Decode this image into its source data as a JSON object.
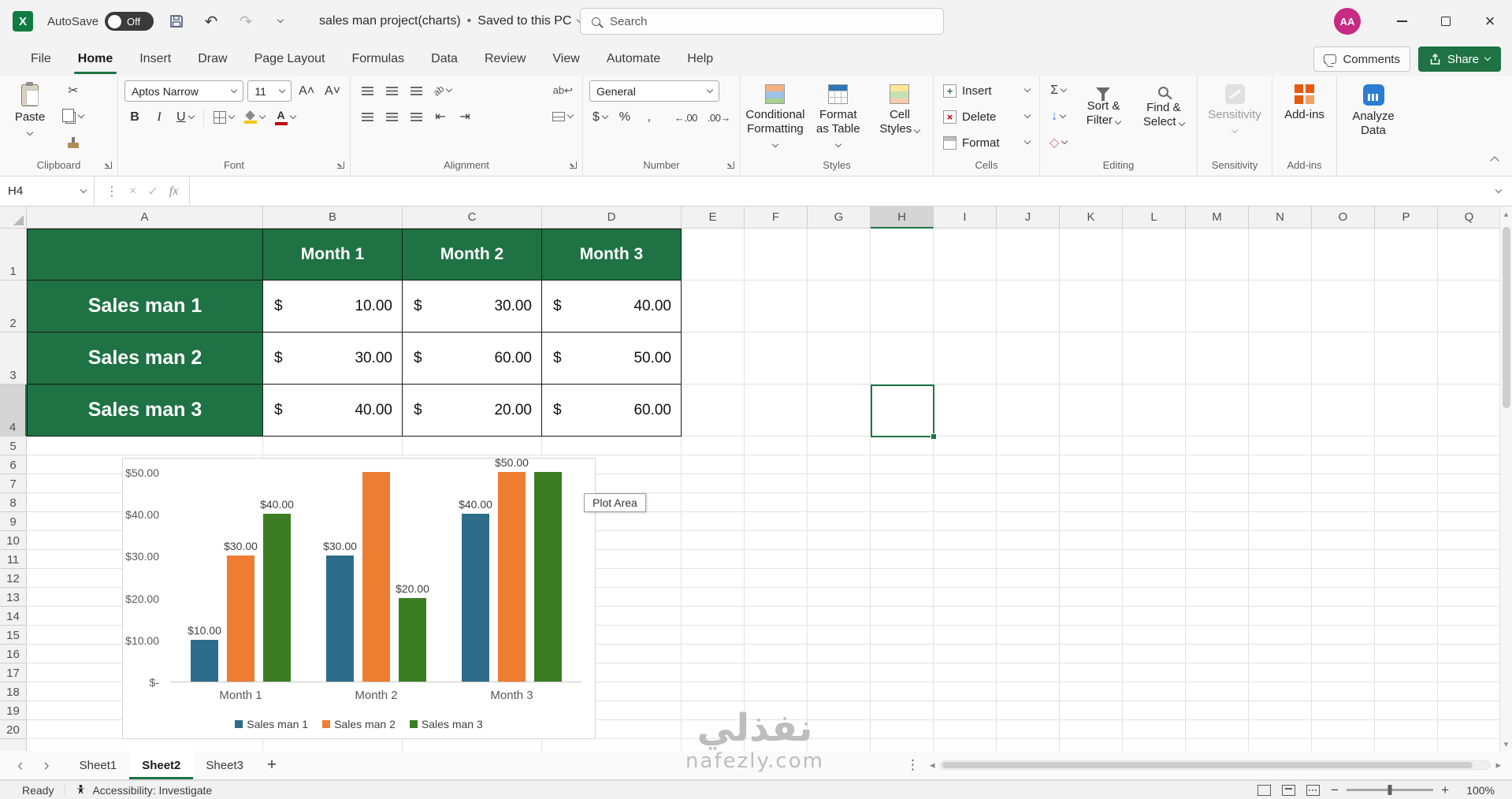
{
  "titlebar": {
    "autosave_label": "AutoSave",
    "autosave_state": "Off",
    "doc_title": "sales man project(charts)",
    "separator": "•",
    "saved_status": "Saved to this PC",
    "search_placeholder": "Search",
    "avatar_initials": "AA"
  },
  "ribbon_tabs": {
    "items": [
      "File",
      "Home",
      "Insert",
      "Draw",
      "Page Layout",
      "Formulas",
      "Data",
      "Review",
      "View",
      "Automate",
      "Help"
    ],
    "active": "Home",
    "comments_label": "Comments",
    "share_label": "Share"
  },
  "ribbon": {
    "groups": {
      "clipboard": {
        "label": "Clipboard",
        "paste": "Paste"
      },
      "font": {
        "label": "Font",
        "name": "Aptos Narrow",
        "size": "11"
      },
      "alignment": {
        "label": "Alignment"
      },
      "number": {
        "label": "Number",
        "format": "General"
      },
      "styles": {
        "label": "Styles",
        "conditional_formatting": "Conditional Formatting",
        "format_as_table": "Format as Table",
        "cell_styles": "Cell Styles"
      },
      "cells": {
        "label": "Cells",
        "insert": "Insert",
        "delete": "Delete",
        "format": "Format"
      },
      "editing": {
        "label": "Editing",
        "sort_filter": "Sort & Filter",
        "find_select": "Find & Select"
      },
      "sensitivity": {
        "label": "Sensitivity",
        "button": "Sensitivity"
      },
      "addins": {
        "label": "Add-ins",
        "button": "Add-ins"
      },
      "analyze": {
        "button": "Analyze Data"
      }
    }
  },
  "icons": {
    "cut": "✂",
    "bold": "B",
    "italic": "I",
    "underline": "U",
    "inc_font": "A˄",
    "dec_font": "A˅",
    "orientation": "ab",
    "wrap": "ab↩",
    "outdent": "⇤",
    "indent": "⇥",
    "currency": "$",
    "percent": "%",
    "comma": ",",
    "inc_decimal": "←.00",
    "dec_decimal": ".00→",
    "autosum": "Σ",
    "fill": "↓",
    "clear": "◇",
    "undo": "↶",
    "redo": "↷",
    "close": "×",
    "kebab": "⋮",
    "plus": "+",
    "nav_left": "‹",
    "nav_right": "›",
    "scroll_left": "◂",
    "scroll_right": "▸",
    "up_arrow": "▴",
    "down_arrow": "▾",
    "cancel": "×",
    "enter": "✓",
    "fx": "fx",
    "minus": "−",
    "plus_zoom": "+"
  },
  "formula_bar": {
    "name_box": "H4",
    "formula": ""
  },
  "grid": {
    "columns": [
      "A",
      "B",
      "C",
      "D",
      "E",
      "F",
      "G",
      "H",
      "I",
      "J",
      "K",
      "L",
      "M",
      "N",
      "O",
      "P",
      "Q"
    ],
    "row_count": 20,
    "selected_cell": "H4",
    "selected_column": "H",
    "selected_row": 4,
    "table": {
      "month_headers": [
        "Month 1",
        "Month 2",
        "Month 3"
      ],
      "rows": [
        {
          "label": "Sales man 1",
          "currency": "$",
          "values": [
            "10.00",
            "30.00",
            "40.00"
          ]
        },
        {
          "label": "Sales man 2",
          "currency": "$",
          "values": [
            "30.00",
            "60.00",
            "50.00"
          ]
        },
        {
          "label": "Sales man 3",
          "currency": "$",
          "values": [
            "40.00",
            "20.00",
            "60.00"
          ]
        }
      ],
      "header_bg": "#1E7244",
      "header_text": "#FFFFFF"
    }
  },
  "chart_data": {
    "type": "bar",
    "title": "",
    "categories": [
      "Month 1",
      "Month 2",
      "Month 3"
    ],
    "series": [
      {
        "name": "Sales man 1",
        "color": "#2E6C8C",
        "values": [
          10,
          30,
          40
        ]
      },
      {
        "name": "Sales man 2",
        "color": "#ED7D31",
        "values": [
          30,
          60,
          50
        ]
      },
      {
        "name": "Sales man 3",
        "color": "#3B7D23",
        "values": [
          40,
          20,
          60
        ]
      }
    ],
    "ylim": [
      0,
      50
    ],
    "ytick_labels": [
      "$-",
      "$10.00",
      "$20.00",
      "$30.00",
      "$40.00",
      "$50.00"
    ],
    "gridlines": false,
    "legend_position": "bottom",
    "data_labels": "shown above bars for values within axis range, format $0.00; bars above $50.00 are clipped at plot top",
    "plot_area_tooltip": "Plot Area"
  },
  "sheet_tabs": {
    "items": [
      {
        "label": "Sheet1",
        "active": false
      },
      {
        "label": "Sheet2",
        "active": true
      },
      {
        "label": "Sheet3",
        "active": false
      }
    ]
  },
  "status_bar": {
    "ready": "Ready",
    "accessibility": "Accessibility: Investigate",
    "zoom": "100%"
  },
  "watermark": {
    "arabic": "نفذلي",
    "domain": "nafezly.com"
  }
}
